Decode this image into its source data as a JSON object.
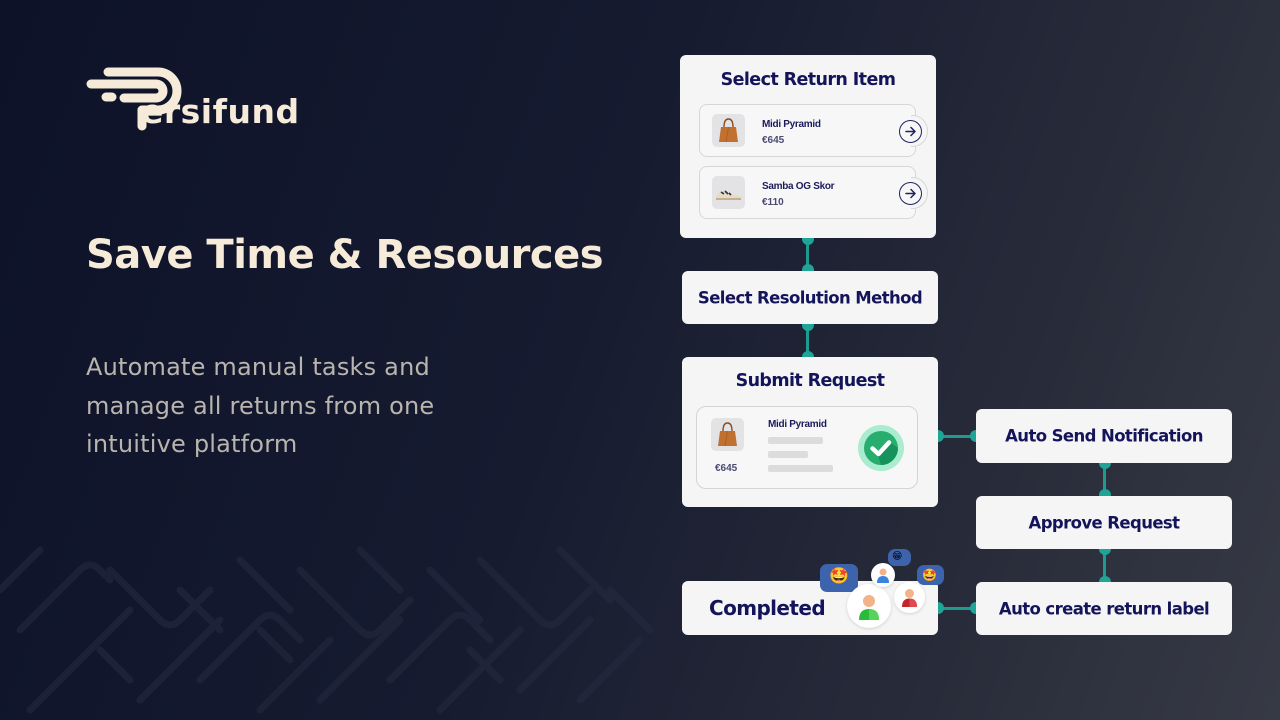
{
  "brand": {
    "name": "ersifund",
    "full_name": "Persifund",
    "logo_icon": "persifund-p-speed-logo",
    "colors": {
      "logo": "#f6ead8",
      "accent": "#1ea597",
      "card_text": "#14145a",
      "background": "#0d1229"
    }
  },
  "hero": {
    "title": "Save Time & Resources",
    "subtitle_lines": [
      "Automate manual tasks and",
      "manage all returns from one",
      "intuitive platform"
    ]
  },
  "flow": {
    "select_return_item": {
      "title": "Select Return Item",
      "items": [
        {
          "name": "Midi Pyramid",
          "price": "€645",
          "icon": "tote-bag-thumbnail",
          "action_icon": "arrow-right-circle-icon"
        },
        {
          "name": "Samba OG Skor",
          "price": "€110",
          "icon": "sneaker-thumbnail",
          "action_icon": "arrow-right-circle-icon"
        }
      ]
    },
    "select_resolution_method": {
      "label": "Select  Resolution Method"
    },
    "submit_request": {
      "title": "Submit Request",
      "item": {
        "name": "Midi Pyramid",
        "price": "€645",
        "icon": "tote-bag-thumbnail"
      },
      "status_icon": "check-circle-icon"
    },
    "auto_send_notification": {
      "label": "Auto Send Notification"
    },
    "approve_request": {
      "label": "Approve Request"
    },
    "auto_create_return_label": {
      "label": "Auto create return label"
    },
    "completed": {
      "label": "Completed",
      "reactions": [
        {
          "avatar": "user-green-avatar",
          "emoji": "🤩"
        },
        {
          "avatar": "user-blue-avatar",
          "emoji": "😁"
        },
        {
          "avatar": "user-red-avatar",
          "emoji": "🤩"
        }
      ]
    }
  }
}
